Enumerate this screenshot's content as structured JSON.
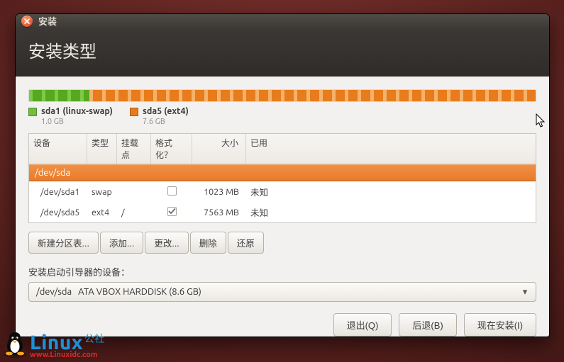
{
  "window": {
    "title": "安装"
  },
  "header": {
    "title": "安装类型"
  },
  "diskbar": {
    "segments": [
      {
        "kind": "green",
        "percent": 11.9
      },
      {
        "kind": "orange",
        "percent": 88.1
      }
    ]
  },
  "legend": [
    {
      "swatch": "green",
      "title": "sda1 (linux-swap)",
      "sub": "1.0 GB"
    },
    {
      "swatch": "orange",
      "title": "sda5 (ext4)",
      "sub": "7.6 GB"
    }
  ],
  "table": {
    "headers": {
      "device": "设备",
      "type": "类型",
      "mount": "挂载点",
      "format": "格式化？",
      "size": "大小",
      "used": "已用"
    },
    "disk_row": "/dev/sda",
    "rows": [
      {
        "device": "/dev/sda1",
        "type": "swap",
        "mount": "",
        "format": false,
        "size": "1023 MB",
        "used": "未知"
      },
      {
        "device": "/dev/sda5",
        "type": "ext4",
        "mount": "/",
        "format": true,
        "size": "7563 MB",
        "used": "未知"
      }
    ]
  },
  "toolbar": {
    "new_table": "新建分区表...",
    "add": "添加...",
    "change": "更改...",
    "delete": "删除",
    "revert": "还原"
  },
  "bootloader": {
    "label": "安装启动引导器的设备：",
    "value": "/dev/sda   ATA VBOX HARDDISK (8.6 GB)"
  },
  "footer": {
    "quit": "退出(Q)",
    "back": "后退(B)",
    "install": "现在安装(I)"
  },
  "watermark": {
    "brand": "Linux",
    "cn": "公社",
    "url": "www.Linuxidc.com"
  },
  "chart_data": {
    "type": "bar",
    "title": "Disk /dev/sda partition usage (8.6 GB)",
    "categories": [
      "sda1 (linux-swap)",
      "sda5 (ext4)"
    ],
    "values": [
      1.0,
      7.6
    ],
    "ylabel": "GB",
    "ylim": [
      0,
      8.6
    ]
  }
}
